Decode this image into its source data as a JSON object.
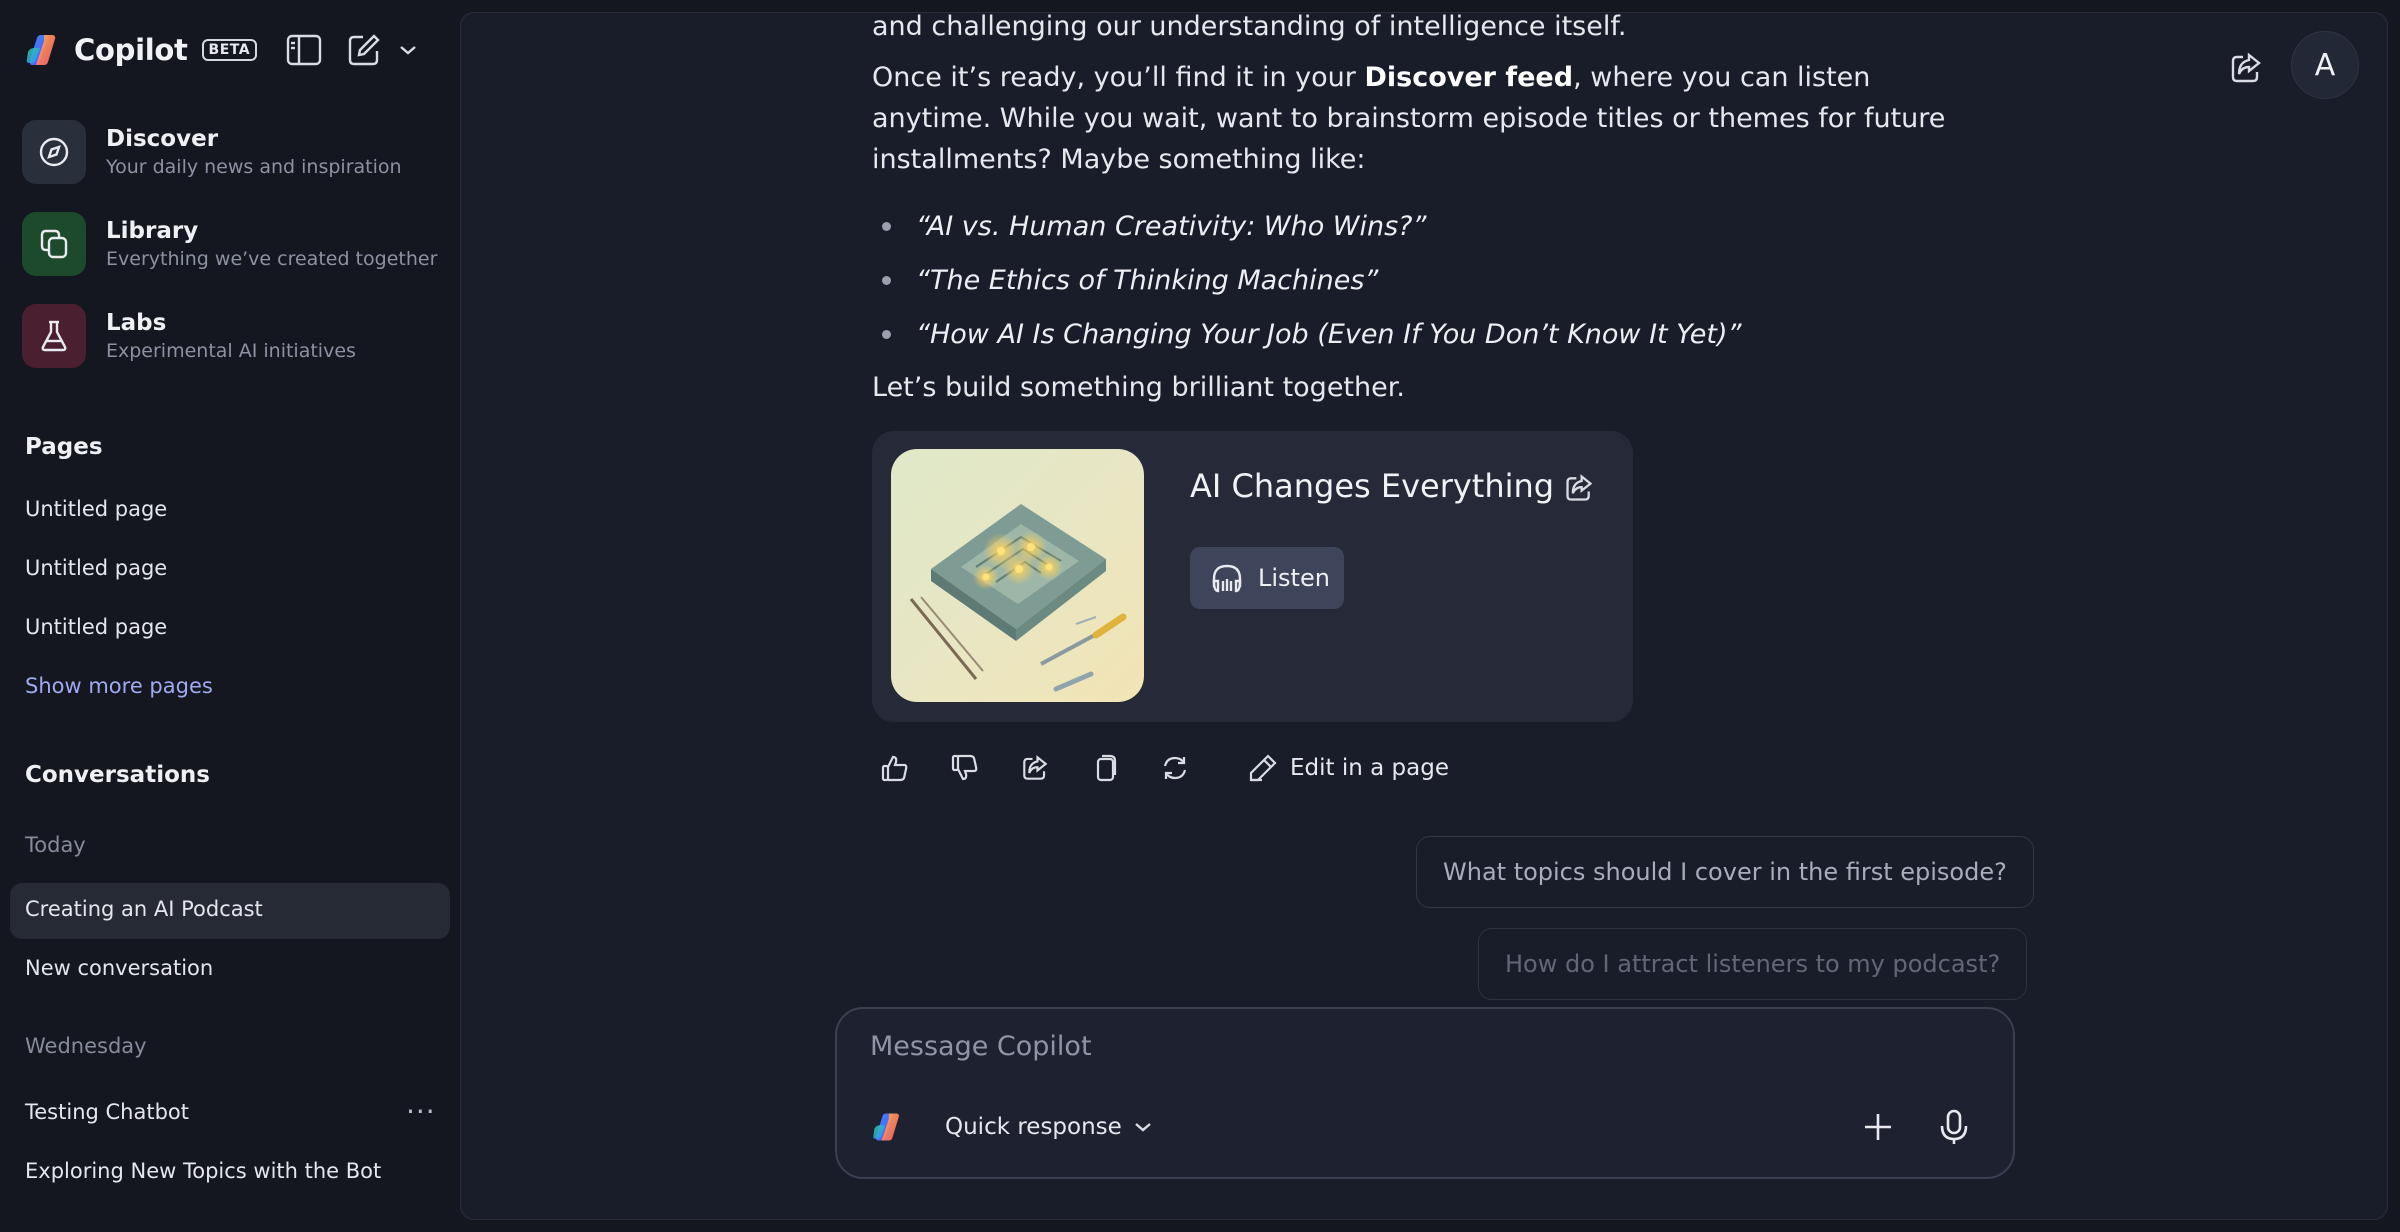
{
  "app": {
    "name": "Copilot",
    "badge": "BETA"
  },
  "nav": [
    {
      "title": "Discover",
      "subtitle": "Your daily news and inspiration",
      "icon": "compass-icon",
      "color": "#2a2f3c"
    },
    {
      "title": "Library",
      "subtitle": "Everything we’ve created together",
      "icon": "library-icon",
      "color": "#1d4a2c"
    },
    {
      "title": "Labs",
      "subtitle": "Experimental AI initiatives",
      "icon": "flask-icon",
      "color": "#4a2030"
    }
  ],
  "pages": {
    "heading": "Pages",
    "items": [
      "Untitled page",
      "Untitled page",
      "Untitled page"
    ],
    "show_more": "Show more pages"
  },
  "conversations": {
    "heading": "Conversations",
    "groups": [
      {
        "label": "Today",
        "items": [
          "Creating an AI Podcast",
          "New conversation"
        ]
      },
      {
        "label": "Wednesday",
        "items": [
          "Testing Chatbot",
          "Exploring New Topics with the Bot"
        ]
      }
    ],
    "more": "···"
  },
  "header": {
    "avatar_letter": "A"
  },
  "message": {
    "top_line": "and challenging our understanding of intelligence itself.",
    "para_before": "Once it’s ready, you’ll find it in your ",
    "para_bold": "Discover feed",
    "para_after": ", where you can listen anytime. While you wait, want to brainstorm episode titles or themes for future installments? Maybe something like:",
    "bullets": [
      "“AI vs. Human Creativity: Who Wins?”",
      "“The Ethics of Thinking Machines”",
      "“How AI Is Changing Your Job (Even If You Don’t Know It Yet)”"
    ],
    "closing": "Let’s build something brilliant together."
  },
  "podcast_card": {
    "title": "AI Changes Everything",
    "listen_label": "Listen"
  },
  "actions": {
    "edit_label": "Edit in a page"
  },
  "suggestions": [
    "What topics should I cover in the first episode?",
    "How do I attract listeners to my podcast?"
  ],
  "composer": {
    "placeholder": "Message Copilot",
    "mode": "Quick response"
  }
}
